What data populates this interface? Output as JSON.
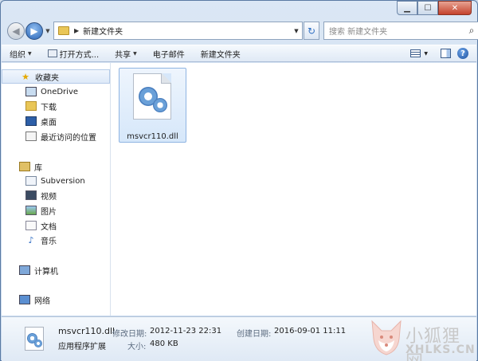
{
  "address": {
    "path": "新建文件夹"
  },
  "search": {
    "placeholder": "搜索 新建文件夹"
  },
  "toolbar": {
    "organize": "组织",
    "open_with": "打开方式...",
    "share": "共享",
    "email": "电子邮件",
    "new_folder": "新建文件夹"
  },
  "sidebar": {
    "favorites": "收藏夹",
    "onedrive": "OneDrive",
    "downloads": "下载",
    "desktop": "桌面",
    "recent": "最近访问的位置",
    "libraries": "库",
    "subversion": "Subversion",
    "videos": "视频",
    "pictures": "图片",
    "documents": "文档",
    "music": "音乐",
    "computer": "计算机",
    "network": "网络"
  },
  "files": [
    {
      "name": "msvcr110.dll"
    }
  ],
  "details": {
    "name": "msvcr110.dll",
    "type": "应用程序扩展",
    "modified_label": "修改日期:",
    "modified_value": "2012-11-23 22:31",
    "created_label": "创建日期:",
    "created_value": "2016-09-01 11:11",
    "size_label": "大小:",
    "size_value": "480 KB"
  },
  "watermark": {
    "cn": "小狐狸网",
    "en": "XHLKS.CN"
  },
  "colors": {
    "accent": "#2863b5",
    "selection": "#dde9f8",
    "close": "#c4422c"
  }
}
